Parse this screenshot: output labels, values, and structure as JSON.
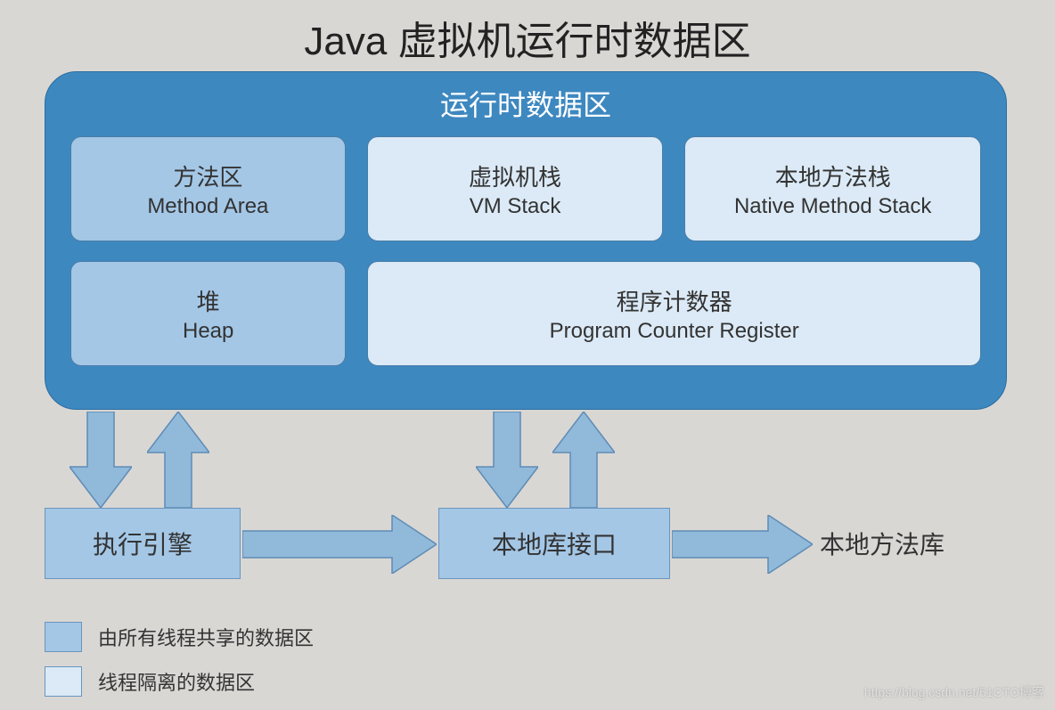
{
  "title": "Java 虚拟机运行时数据区",
  "runtime": {
    "header": "运行时数据区",
    "method_area": {
      "cn": "方法区",
      "en": "Method Area"
    },
    "vm_stack": {
      "cn": "虚拟机栈",
      "en": "VM Stack"
    },
    "native_stack": {
      "cn": "本地方法栈",
      "en": "Native Method Stack"
    },
    "heap": {
      "cn": "堆",
      "en": "Heap"
    },
    "pc_register": {
      "cn": "程序计数器",
      "en": "Program Counter Register"
    }
  },
  "exec_engine": "执行引擎",
  "native_lib_interface": "本地库接口",
  "native_lib": "本地方法库",
  "legend": {
    "shared": "由所有线程共享的数据区",
    "private": "线程隔离的数据区"
  },
  "colors": {
    "shared": "#a4c7e6",
    "private": "#dbeaf6",
    "container": "#3e88c0",
    "arrow_fill": "#90b9da",
    "arrow_stroke": "#5f8cb5"
  },
  "watermark": "https://blog.csdn.net/51CTO博客"
}
